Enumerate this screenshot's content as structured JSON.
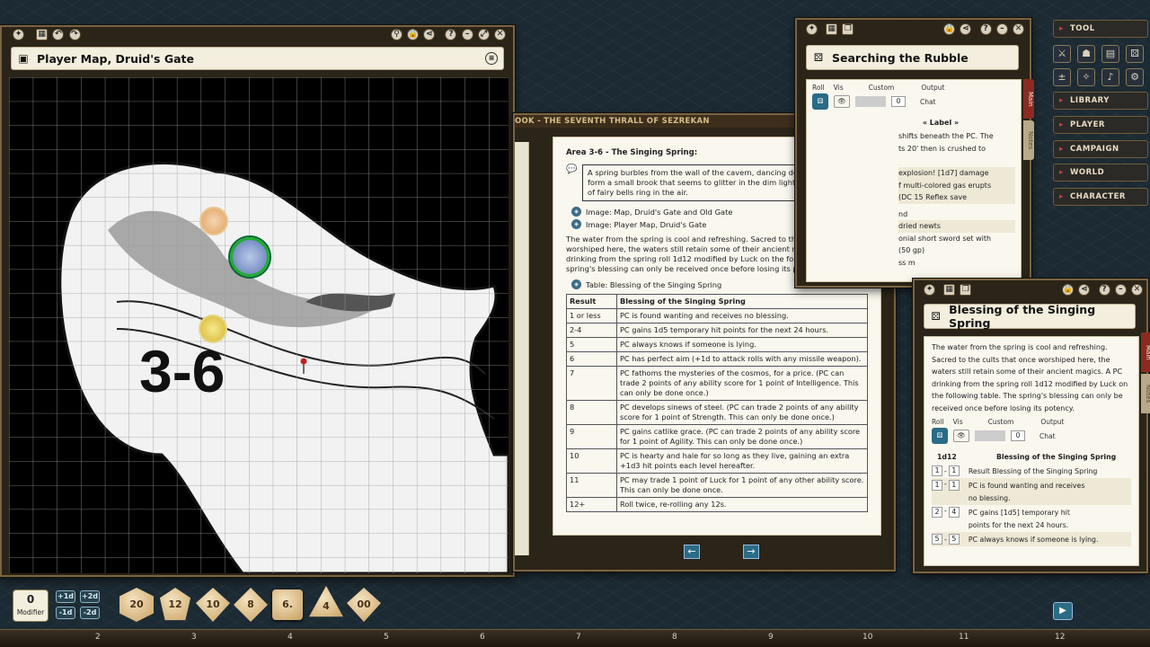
{
  "map_window": {
    "title": "Player Map, Druid's Gate",
    "area_label": "3-6"
  },
  "story_window": {
    "header": "OOK - THE SEVENTH THRALL OF SEZREKAN",
    "area_title": "Area 3-6 - The Singing Spring:",
    "boxed_text": "A spring burbles from the wall of the cavern, dancing down the stones to form a small brook that seems to glitter in the dim light. The faint sounds of fairy bells ring in the air.",
    "links": [
      "Image: Map, Druid's Gate and Old Gate",
      "Image: Player Map, Druid's Gate"
    ],
    "body": "The water from the spring is cool and refreshing. Sacred to the cults that once worshiped here, the waters still retain some of their ancient magics. A PC drinking from the spring roll 1d12 modified by Luck on the following table. The spring's blessing can only be received once before losing its potency.",
    "table_link": "Table: Blessing of the Singing Spring",
    "table": {
      "headers": [
        "Result",
        "Blessing of the Singing Spring"
      ],
      "rows": [
        [
          "1 or less",
          "PC is found wanting and receives no blessing."
        ],
        [
          "2-4",
          "PC gains 1d5 temporary hit points for the next 24 hours."
        ],
        [
          "5",
          "PC always knows if someone is lying."
        ],
        [
          "6",
          "PC has perfect aim (+1d to attack rolls with any missile weapon)."
        ],
        [
          "7",
          "PC fathoms the mysteries of the cosmos, for a price. (PC can trade 2 points of any ability score for 1 point of Intelligence. This can only be done once.)"
        ],
        [
          "8",
          "PC develops sinews of steel. (PC can trade 2 points of any ability score for 1 point of Strength. This can only be done once.)"
        ],
        [
          "9",
          "PC gains catlike grace. (PC can trade 2 points of any ability score for 1 point of Agility. This can only be done once.)"
        ],
        [
          "10",
          "PC is hearty and hale for so long as they live, gaining an extra +1d3 hit points each level hereafter."
        ],
        [
          "11",
          "PC may trade 1 point of Luck for 1 point of any other ability score. This can only be done once."
        ],
        [
          "12+",
          "Roll twice, re-rolling any 12s."
        ]
      ]
    },
    "prev_label": "←",
    "next_label": "→"
  },
  "rubble_window": {
    "title": "Searching the Rubble",
    "controls": {
      "roll": "Roll",
      "vis": "Vis",
      "custom": "Custom",
      "output": "Output",
      "custom_value": "0",
      "output_value": "Chat"
    },
    "label_heading": "« Label »",
    "fragments": [
      "shifts beneath the PC. The",
      "ts 20' then is crushed to",
      "explosion! [1d7] damage",
      "f multi-colored gas erupts",
      "(DC 15 Reflex save",
      "nd",
      "dried newts",
      "onial short sword set with",
      "(50 gp)",
      "ss m"
    ],
    "tabs": [
      "Main",
      "Notes"
    ]
  },
  "blessing_window": {
    "title": "Blessing of the Singing Spring",
    "description": "The water from the spring is cool and refreshing. Sacred to the cults that once worshiped here, the waters still retain some of their ancient magics. A PC drinking from the spring roll 1d12 modified by Luck on the following table. The spring's blessing can only be received once before losing its potency.",
    "controls": {
      "roll": "Roll",
      "vis": "Vis",
      "custom": "Custom",
      "output": "Output",
      "custom_value": "0",
      "output_value": "Chat"
    },
    "table_head": [
      "1d12",
      "Blessing of the Singing Spring"
    ],
    "rows": [
      {
        "from": "1",
        "to": "1",
        "text": "Result Blessing of the Singing Spring"
      },
      {
        "from": "1",
        "to": "1",
        "text": "PC is found wanting and receives no blessing."
      },
      {
        "from": "2",
        "to": "4",
        "text": "PC gains [1d5] temporary hit points for the next 24 hours."
      },
      {
        "from": "5",
        "to": "5",
        "text": "PC always knows if someone is lying."
      }
    ],
    "tabs": [
      "Main",
      "Notes"
    ]
  },
  "sidebar": {
    "tool_label": "TOOL",
    "buttons": [
      "LIBRARY",
      "PLAYER",
      "CAMPAIGN",
      "WORLD",
      "CHARACTER"
    ]
  },
  "dice_bar": {
    "modifier_value": "0",
    "modifier_label": "Modifier",
    "mod_buttons": [
      "+1d",
      "+2d",
      "-1d",
      "-2d"
    ],
    "dice": [
      "20",
      "12",
      "10",
      "8",
      "6.",
      "4",
      "00"
    ]
  },
  "hotbar": {
    "numbers": [
      "2",
      "3",
      "4",
      "5",
      "6",
      "7",
      "8",
      "9",
      "10",
      "11",
      "12"
    ]
  },
  "colors": {
    "accent": "#8b2a20",
    "frame": "#7a6440",
    "paper": "#faf7ee"
  }
}
